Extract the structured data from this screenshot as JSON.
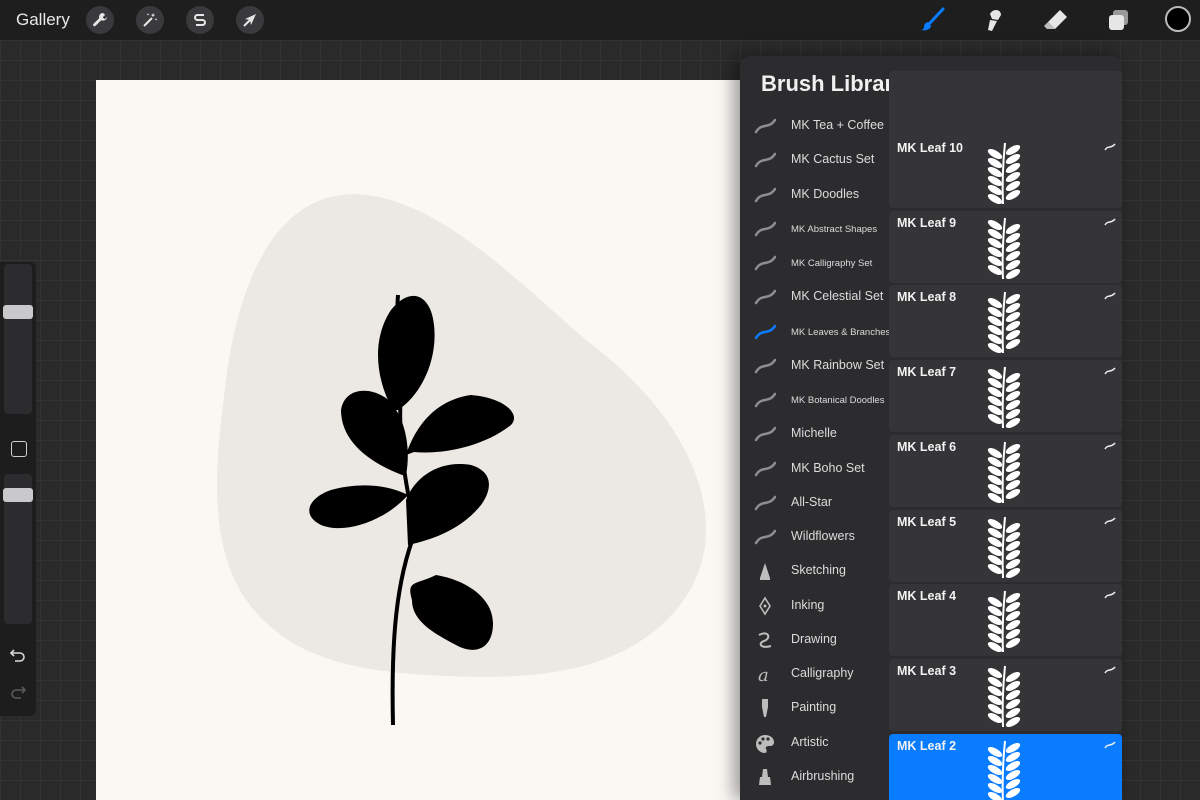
{
  "toolbar": {
    "gallery_label": "Gallery",
    "left_icons": [
      "wrench-icon",
      "magic-wand-icon",
      "selection-s-icon",
      "arrow-cursor-icon"
    ],
    "right_icons": [
      "brush-icon",
      "smudge-icon",
      "eraser-icon",
      "layers-icon"
    ],
    "active_tool": "brush-icon",
    "current_color": "#000000",
    "accent_color": "#0a7cff"
  },
  "sidebar": {
    "size_slider_level": 0.3,
    "opacity_slider_level": 0.1,
    "icons": [
      "modify-square-icon",
      "undo-icon",
      "redo-icon"
    ]
  },
  "canvas": {
    "background": "#fbf8f4",
    "blob_color": "#ece8e3",
    "artwork": "black leaf branch"
  },
  "brush_library": {
    "title": "Brush Library",
    "add_icon": "plus-icon",
    "sets": [
      {
        "label": "MK Tea + Coffee",
        "small": false,
        "icon": "stroke-icon",
        "active": false
      },
      {
        "label": "MK Cactus Set",
        "small": false,
        "icon": "stroke-icon",
        "active": false
      },
      {
        "label": "MK Doodles",
        "small": false,
        "icon": "stroke-icon",
        "active": false
      },
      {
        "label": "MK Abstract Shapes",
        "small": true,
        "icon": "stroke-icon",
        "active": false
      },
      {
        "label": "MK Calligraphy Set",
        "small": true,
        "icon": "stroke-icon",
        "active": false
      },
      {
        "label": "MK Celestial Set",
        "small": false,
        "icon": "stroke-icon",
        "active": false
      },
      {
        "label": "MK Leaves & Branches",
        "small": true,
        "icon": "stroke-icon",
        "active": true
      },
      {
        "label": "MK Rainbow Set",
        "small": false,
        "icon": "stroke-icon",
        "active": false
      },
      {
        "label": "MK Botanical Doodles",
        "small": true,
        "icon": "stroke-icon",
        "active": false
      },
      {
        "label": "Michelle",
        "small": false,
        "icon": "stroke-icon",
        "active": false
      },
      {
        "label": "MK Boho Set",
        "small": false,
        "icon": "stroke-icon",
        "active": false
      },
      {
        "label": "All-Star",
        "small": false,
        "icon": "stroke-icon",
        "active": false
      },
      {
        "label": "Wildflowers",
        "small": false,
        "icon": "stroke-icon",
        "active": false
      },
      {
        "label": "Sketching",
        "small": false,
        "icon": "pencil-tip-icon",
        "active": false
      },
      {
        "label": "Inking",
        "small": false,
        "icon": "pen-nib-icon",
        "active": false
      },
      {
        "label": "Drawing",
        "small": false,
        "icon": "swirl-icon",
        "active": false
      },
      {
        "label": "Calligraphy",
        "small": false,
        "icon": "script-a-icon",
        "active": false
      },
      {
        "label": "Painting",
        "small": false,
        "icon": "paint-brush-icon",
        "active": false
      },
      {
        "label": "Artistic",
        "small": false,
        "icon": "palette-icon",
        "active": false
      },
      {
        "label": "Airbrushing",
        "small": false,
        "icon": "airbrush-icon",
        "active": false
      }
    ],
    "brushes": [
      {
        "name": "MK Leaf 10",
        "selected": false
      },
      {
        "name": "MK Leaf 9",
        "selected": false
      },
      {
        "name": "MK Leaf 8",
        "selected": false
      },
      {
        "name": "MK Leaf 7",
        "selected": false
      },
      {
        "name": "MK Leaf 6",
        "selected": false
      },
      {
        "name": "MK Leaf 5",
        "selected": false
      },
      {
        "name": "MK Leaf 4",
        "selected": false
      },
      {
        "name": "MK Leaf 3",
        "selected": false
      },
      {
        "name": "MK Leaf 2",
        "selected": true
      }
    ]
  }
}
